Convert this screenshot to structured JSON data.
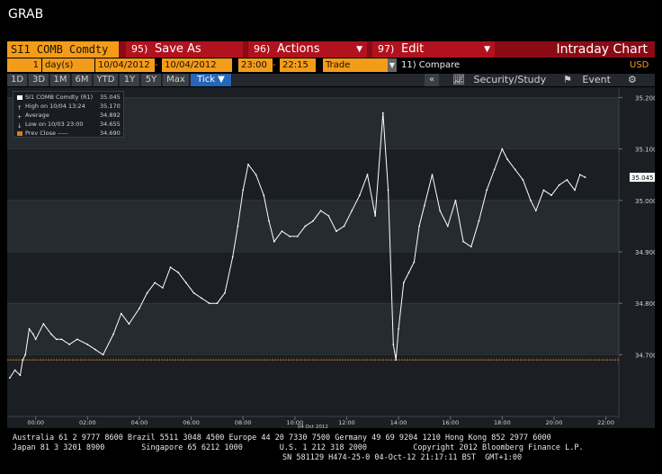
{
  "app_title": "GRAB",
  "function_bar": {
    "security": "SI1 COMB Comdty",
    "buttons": [
      {
        "num": "95)",
        "label": "Save As"
      },
      {
        "num": "96)",
        "label": "Actions"
      },
      {
        "num": "97)",
        "label": "Edit"
      }
    ],
    "view_title": "Intraday Chart"
  },
  "params": {
    "period_count": "1",
    "period_unit": "day(s)",
    "date_from": "10/04/2012",
    "date_to": "10/04/2012",
    "time_from": "23:00",
    "time_to": "22:15",
    "event_type": "Trade",
    "compare": "11) Compare",
    "currency": "USD"
  },
  "toolbar": {
    "ranges": [
      "1D",
      "3D",
      "1M",
      "6M",
      "YTD",
      "1Y",
      "5Y",
      "Max"
    ],
    "selected": "Tick ▼",
    "security_study": "Security/Study",
    "event": "Event",
    "collapse": "«"
  },
  "legend": [
    {
      "label": "SI1 COMB Comdty (R1)",
      "value": "35.045"
    },
    {
      "label": "High on 10/04 13:24",
      "value": "35.170"
    },
    {
      "label": "Average",
      "value": "34.892"
    },
    {
      "label": "Low on 10/03 23:00",
      "value": "34.655"
    },
    {
      "label": "Prev Close -----",
      "value": "34.690"
    }
  ],
  "colors": {
    "price": "#ffffff",
    "prev_close": "#e07b1a",
    "brand_orange": "#f39c1a",
    "brand_red": "#b1121e"
  },
  "chart_data": {
    "type": "line",
    "xlabel": "",
    "ylabel": "",
    "ylim": [
      34.58,
      35.22
    ],
    "yticks": [
      "35.200",
      "35.100",
      "35.000",
      "34.900",
      "34.800",
      "34.700"
    ],
    "ytick_values": [
      35.2,
      35.1,
      35.0,
      34.9,
      34.8,
      34.7
    ],
    "current_label": "35.045",
    "current_value": 35.045,
    "prev_close": 34.69,
    "xticks": [
      "00:00",
      "02:00",
      "04:00",
      "06:00",
      "08:00",
      "10:00",
      "12:00",
      "14:00",
      "16:00",
      "18:00",
      "20:00",
      "22:00"
    ],
    "xtick_hours": [
      0,
      2,
      4,
      6,
      8,
      10,
      12,
      14,
      16,
      18,
      20,
      22
    ],
    "date_label": "04 Oct 2012",
    "date_label_hour": 10,
    "x_hours": [
      -1,
      -0.8,
      -0.6,
      -0.5,
      -0.4,
      -0.25,
      -0.1,
      0.0,
      0.3,
      0.6,
      0.8,
      1.0,
      1.3,
      1.6,
      2.0,
      2.3,
      2.6,
      3.0,
      3.3,
      3.6,
      4.0,
      4.3,
      4.6,
      4.9,
      5.2,
      5.5,
      5.8,
      6.1,
      6.4,
      6.7,
      7.0,
      7.3,
      7.6,
      7.8,
      8.0,
      8.2,
      8.5,
      8.8,
      9.0,
      9.2,
      9.5,
      9.8,
      10.1,
      10.4,
      10.7,
      11.0,
      11.3,
      11.6,
      11.9,
      12.2,
      12.5,
      12.8,
      13.1,
      13.4,
      13.6,
      13.8,
      13.9,
      14.0,
      14.2,
      14.4,
      14.6,
      14.8,
      15.0,
      15.3,
      15.6,
      15.9,
      16.2,
      16.5,
      16.8,
      17.1,
      17.4,
      17.7,
      18.0,
      18.2,
      18.5,
      18.8,
      19.1,
      19.3,
      19.6,
      19.9,
      20.2,
      20.5,
      20.8,
      21.0,
      21.2
    ],
    "values": [
      34.655,
      34.67,
      34.66,
      34.69,
      34.7,
      34.75,
      34.74,
      34.73,
      34.76,
      34.74,
      34.73,
      34.73,
      34.72,
      34.73,
      34.72,
      34.71,
      34.7,
      34.74,
      34.78,
      34.76,
      34.79,
      34.82,
      34.84,
      34.83,
      34.87,
      34.86,
      34.84,
      34.82,
      34.81,
      34.8,
      34.8,
      34.82,
      34.89,
      34.95,
      35.02,
      35.07,
      35.05,
      35.01,
      34.96,
      34.92,
      34.94,
      34.93,
      34.93,
      34.95,
      34.96,
      34.98,
      34.97,
      34.94,
      34.95,
      34.98,
      35.01,
      35.05,
      34.97,
      35.17,
      35.02,
      34.72,
      34.69,
      34.75,
      34.84,
      34.86,
      34.88,
      34.95,
      34.99,
      35.05,
      34.98,
      34.95,
      35.0,
      34.92,
      34.91,
      34.96,
      35.02,
      35.06,
      35.1,
      35.08,
      35.06,
      35.04,
      35.0,
      34.98,
      35.02,
      35.01,
      35.03,
      35.04,
      35.02,
      35.05,
      35.045
    ]
  },
  "footer": {
    "line1": "Australia 61 2 9777 8600 Brazil 5511 3048 4500 Europe 44 20 7330 7500 Germany 49 69 9204 1210 Hong Kong 852 2977 6000",
    "line2": "Japan 81 3 3201 8900        Singapore 65 6212 1000        U.S. 1 212 318 2000          Copyright 2012 Bloomberg Finance L.P.",
    "line3": "SN 581129 H474-25-0 04-Oct-12 21:17:11 BST  GMT+1:00"
  }
}
